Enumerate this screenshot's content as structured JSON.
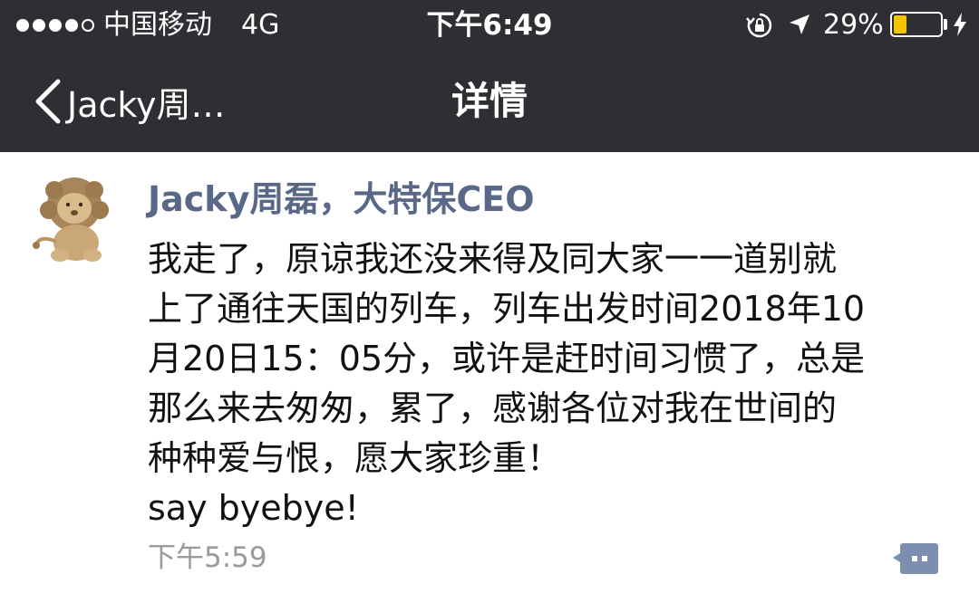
{
  "status_bar": {
    "carrier": "中国移动",
    "network": "4G",
    "time": "下午6:49",
    "battery_percent": "29%",
    "battery_level": 0.29,
    "battery_color": "#f2c500",
    "icons": [
      "signal-dots",
      "orientation-lock-icon",
      "location-arrow-icon",
      "battery-icon",
      "charging-bolt-icon"
    ]
  },
  "nav": {
    "back_label": "Jacky周…",
    "title": "详情"
  },
  "post": {
    "sender": "Jacky周磊，大特保CEO",
    "sender_color": "#5a6888",
    "message_lines": [
      "我走了，原谅我还没来得及同大家一一道别就",
      "上了通往天国的列车，列车出发时间2018年10",
      "月20日15：05分，或许是赶时间习惯了，总是",
      "那么来去匆匆，累了，感谢各位对我在世间的",
      "种种爱与恨，愿大家珍重！",
      "say byebye!"
    ],
    "time": "下午5:59",
    "avatar_icon": "lion-plush-avatar",
    "action_icon": "comment-icon"
  }
}
